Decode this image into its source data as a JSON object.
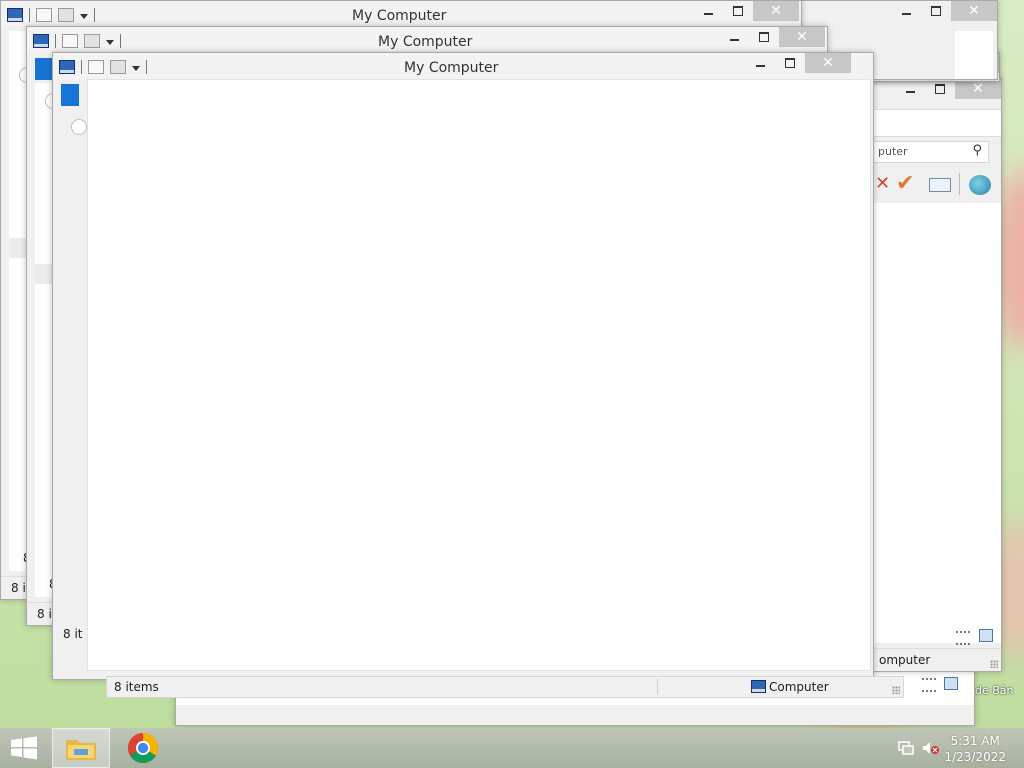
{
  "windows": {
    "title": "My Computer",
    "status_items": "8 items",
    "status_items_truncated": "8 it",
    "status_items_stub": "8",
    "status_location": "Computer",
    "status_location_cut": "omputer",
    "search_text": "puter"
  },
  "desktop": {
    "partial_icon_label": "de Bản"
  },
  "taskbar": {
    "time": "5:31 AM",
    "date": "1/23/2022",
    "apps": [
      {
        "name": "file-explorer",
        "active": true
      },
      {
        "name": "chrome",
        "active": false
      }
    ]
  },
  "colors": {
    "accent_blue": "#1874d4",
    "close_button": "#c7c7c7",
    "taskbar": "#a7b1a0"
  }
}
